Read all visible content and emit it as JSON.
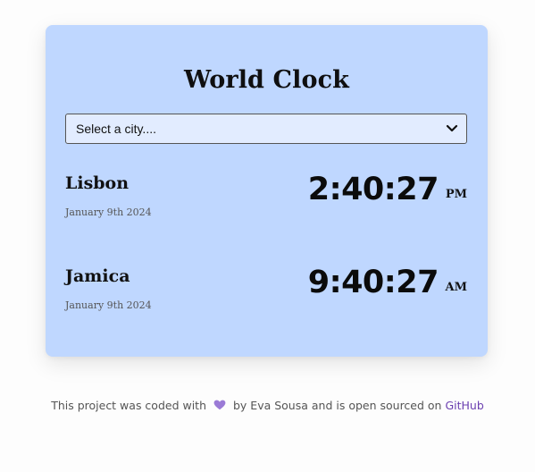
{
  "app": {
    "title": "World Clock"
  },
  "city_select": {
    "selected": "Select a city...."
  },
  "cities": [
    {
      "name": "Lisbon",
      "date": "January 9th 2024",
      "time": "2:40:27",
      "ampm": "PM"
    },
    {
      "name": "Jamica",
      "date": "January 9th 2024",
      "time": "9:40:27",
      "ampm": "AM"
    }
  ],
  "footer": {
    "text_before": "This project was coded with",
    "heart_icon": "heart-icon",
    "text_after": "by Eva Sousa and is open sourced on",
    "link_label": "GitHub"
  },
  "colors": {
    "card_background": "#bfd7ff",
    "select_background": "#e2ecff",
    "link": "#6b3fb0",
    "heart": "#9b7bd6"
  }
}
